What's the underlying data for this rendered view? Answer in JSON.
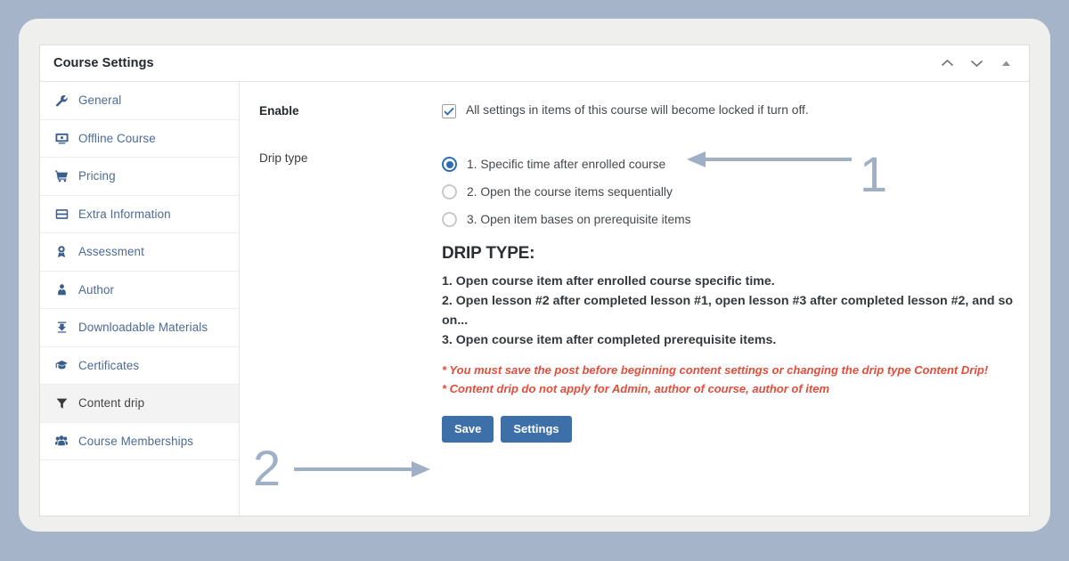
{
  "window": {
    "title": "Course Settings",
    "controls": [
      {
        "name": "collapse-up",
        "glyph": "⌃"
      },
      {
        "name": "expand-down",
        "glyph": "⌄"
      },
      {
        "name": "toggle-panel",
        "glyph": "▲"
      }
    ]
  },
  "sidebar": {
    "items": [
      {
        "label": "General",
        "icon": "wrench-icon",
        "active": false
      },
      {
        "label": "Offline Course",
        "icon": "monitor-icon",
        "active": false
      },
      {
        "label": "Pricing",
        "icon": "cart-icon",
        "active": false
      },
      {
        "label": "Extra Information",
        "icon": "window-layout-icon",
        "active": false
      },
      {
        "label": "Assessment",
        "icon": "award-ribbon-icon",
        "active": false
      },
      {
        "label": "Author",
        "icon": "user-tie-icon",
        "active": false
      },
      {
        "label": "Downloadable Materials",
        "icon": "download-icon",
        "active": false
      },
      {
        "label": "Certificates",
        "icon": "graduation-cap-icon",
        "active": false
      },
      {
        "label": "Content drip",
        "icon": "funnel-filter-icon",
        "active": true
      },
      {
        "label": "Course Memberships",
        "icon": "users-group-icon",
        "active": false
      }
    ]
  },
  "main": {
    "enable": {
      "label": "Enable",
      "checkbox_checked": true,
      "checkbox_text": "All settings in items of this course will become locked if turn off."
    },
    "drip_type": {
      "label": "Drip type",
      "options": [
        {
          "text": "1. Specific time after enrolled course",
          "selected": true
        },
        {
          "text": "2. Open the course items sequentially",
          "selected": false
        },
        {
          "text": "3. Open item bases on prerequisite items",
          "selected": false
        }
      ]
    },
    "description": {
      "heading": "DRIP TYPE:",
      "lines": [
        "1. Open course item after enrolled course specific time.",
        "2. Open lesson #2 after completed lesson #1, open lesson #3 after completed lesson #2, and so on...",
        "3. Open course item after completed prerequisite items."
      ],
      "warnings": [
        "* You must save the post before beginning content settings or changing the drip type Content Drip!",
        "* Content drip do not apply for Admin, author of course, author of item"
      ]
    },
    "buttons": {
      "save_label": "Save",
      "settings_label": "Settings"
    }
  },
  "annotations": [
    {
      "number": "1",
      "direction": "left",
      "target": "drip-type-option-1"
    },
    {
      "number": "2",
      "direction": "right",
      "target": "save-button"
    }
  ],
  "colors": {
    "page_background": "#a6b4ca",
    "card_background": "#efefee",
    "panel_background": "#ffffff",
    "sidebar_link": "#4a6b96",
    "sidebar_icon": "#3a5e8c",
    "active_item_background": "#f3f3f3",
    "accent_blue": "#2b6cb4",
    "button_blue": "#3d6fa8",
    "warning_red": "#e04f3b",
    "annotation_gray_blue": "#9fafc6"
  }
}
